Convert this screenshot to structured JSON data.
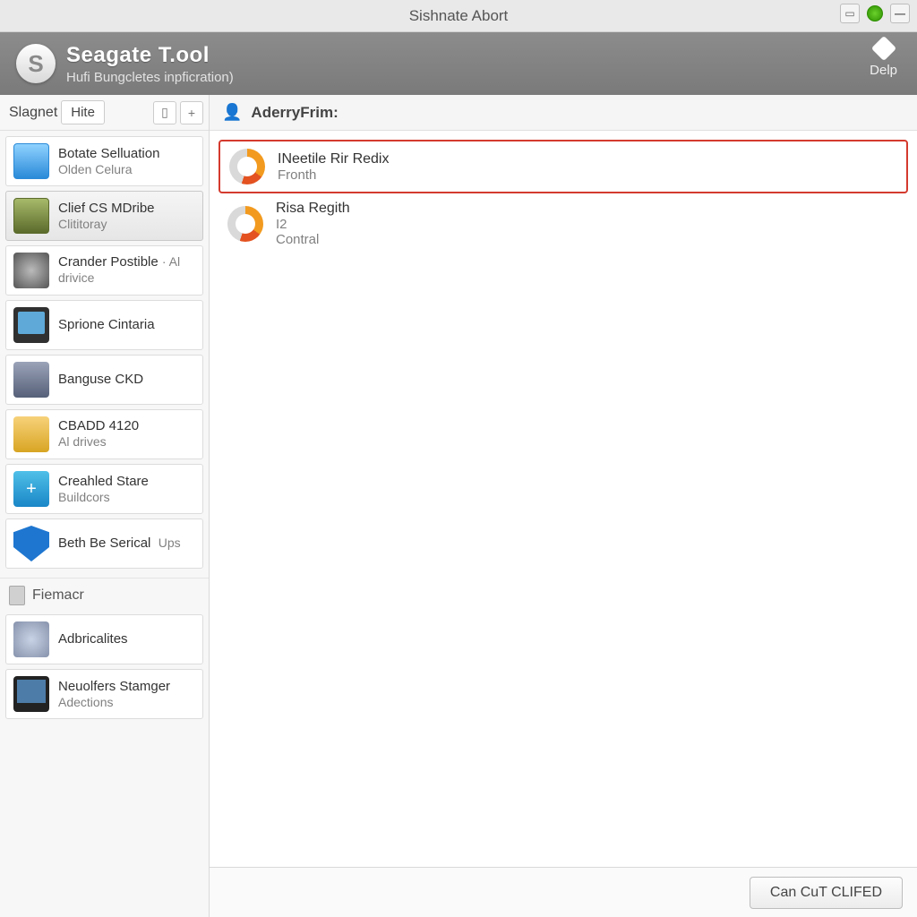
{
  "titlebar": {
    "title": "Sishnate Abort"
  },
  "header": {
    "app_title": "Seagate T.ool",
    "subtitle": "Hufi Bungcletes inpficration)",
    "help_label": "Delp"
  },
  "sidebar": {
    "crumb_label": "Slagnet",
    "crumb_value": "Hite",
    "items": [
      {
        "title": "Botate Selluation",
        "subtitle": "Olden Celura"
      },
      {
        "title": "Clief CS MDribe",
        "subtitle": "Clititoray"
      },
      {
        "title": "Crander Postible",
        "subtitle": "· Al drivice"
      },
      {
        "title": "Sprione  Cintaria",
        "subtitle": ""
      },
      {
        "title": "Banguse CKD",
        "subtitle": ""
      },
      {
        "title": "CBADD 4120",
        "subtitle": "Al drives"
      },
      {
        "title": "Creahled Stare",
        "subtitle": "Buildcors"
      },
      {
        "title": "Beth Be Serical",
        "subtitle": "Ups"
      }
    ],
    "section_label": "Fiemacr",
    "extra": [
      {
        "title": "Adbricalites",
        "subtitle": ""
      },
      {
        "title": "Neuolfers Stamger",
        "subtitle": "Adections"
      }
    ]
  },
  "main": {
    "heading": "AderryFrim:",
    "items": [
      {
        "title": "INeetile Rir Redix",
        "subtitle": "Fronth"
      },
      {
        "title": "Risa Regith",
        "subtitle": "I2",
        "subtitle2": "Contral"
      }
    ]
  },
  "footer": {
    "button": "Can CuT CLIFED"
  }
}
